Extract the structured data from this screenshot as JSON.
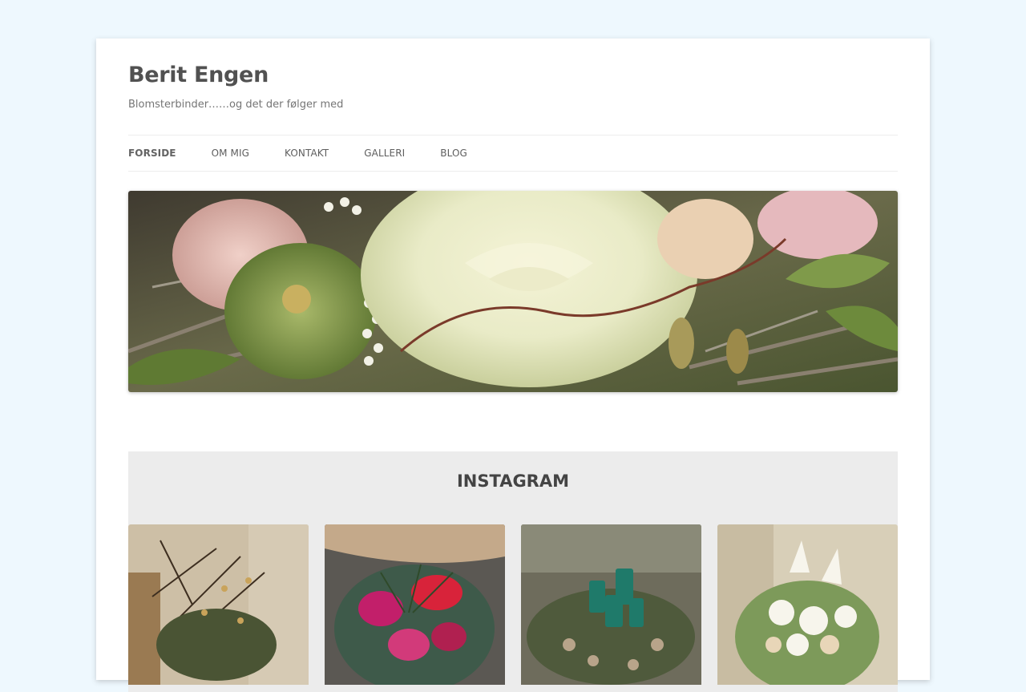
{
  "site": {
    "title": "Berit Engen",
    "description": "Blomsterbinder……og det der følger med"
  },
  "nav": {
    "items": [
      {
        "label": "FORSIDE",
        "current": true
      },
      {
        "label": "OM MIG",
        "current": false
      },
      {
        "label": "KONTAKT",
        "current": false
      },
      {
        "label": "GALLERI",
        "current": false
      },
      {
        "label": "BLOG",
        "current": false
      }
    ]
  },
  "header_image": {
    "icon": "flower-arrangement-photo"
  },
  "instagram": {
    "title": "INSTAGRAM",
    "tiles": [
      {
        "icon": "branch-arrangement-photo"
      },
      {
        "icon": "red-bouquet-photo"
      },
      {
        "icon": "candle-wreath-photo"
      },
      {
        "icon": "white-lilies-photo"
      }
    ]
  },
  "colors": {
    "background": "#eef8fe",
    "page": "#ffffff",
    "instagram_bg": "#ececec",
    "title": "#515151"
  }
}
